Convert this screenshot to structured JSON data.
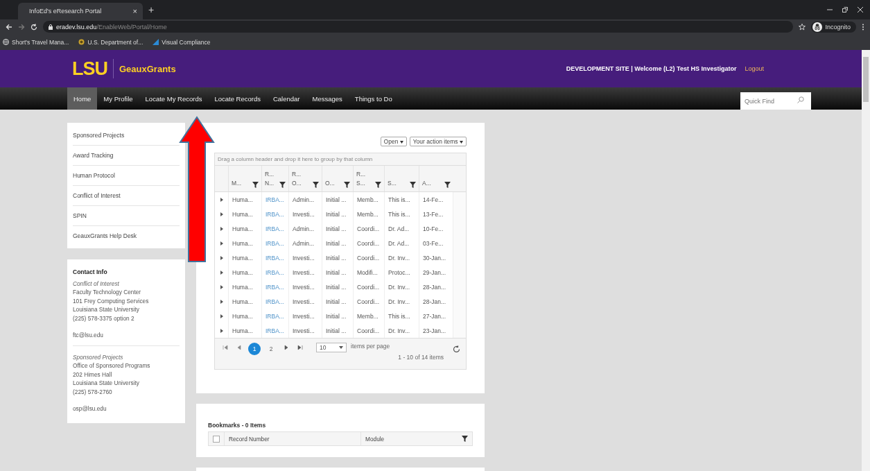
{
  "browser": {
    "tab_title": "InfoEd's eResearch Portal",
    "tab_close": "×",
    "new_tab": "+",
    "url_host": "eradev.lsu.edu",
    "url_path": "/EnableWeb/Portal/Home",
    "profile": "Incognito",
    "bookmarks": [
      "Short's Travel Mana...",
      "U.S. Department of...",
      "Visual Compliance"
    ]
  },
  "header": {
    "logo": "LSU",
    "app_name": "GeauxGrants",
    "welcome": "DEVELOPMENT SITE | Welcome (L2) Test HS Investigator",
    "logout": "Logout"
  },
  "nav": {
    "items": [
      {
        "label": "Home",
        "selected": true
      },
      {
        "label": "My Profile",
        "selected": false
      },
      {
        "label": "Locate My Records",
        "selected": false
      },
      {
        "label": "Locate Records",
        "selected": false
      },
      {
        "label": "Calendar",
        "selected": false
      },
      {
        "label": "Messages",
        "selected": false
      },
      {
        "label": "Things to Do",
        "selected": false
      }
    ],
    "quick_find": {
      "placeholder": "Quick Find"
    }
  },
  "sidebar": {
    "items": [
      "Sponsored Projects",
      "Award Tracking",
      "Human Protocol",
      "Conflict of Interest",
      "SPIN",
      "GeauxGrants Help Desk"
    ]
  },
  "contact": {
    "title": "Contact Info",
    "groups": [
      {
        "unit": "Conflict of Interest",
        "lines": [
          "Faculty Technology Center",
          "101 Frey Computing Services",
          "Louisiana State University",
          "(225) 578-3375 option 2"
        ],
        "email": "ftc@lsu.edu"
      },
      {
        "unit": "Sponsored Projects",
        "lines": [
          "Office of Sponsored Programs",
          "202 Himes Hall",
          "Louisiana State University",
          "(225) 578-2760"
        ],
        "email": "osp@lsu.edu"
      }
    ]
  },
  "grid": {
    "filters": [
      "Open",
      "Your action items"
    ],
    "group_hint": "Drag a column header and drop it here to group by that column",
    "columns": [
      "M...",
      "R... N...",
      "R... O...",
      "O...",
      "R... S...",
      "S...",
      "A..."
    ],
    "rows": [
      [
        "Huma...",
        "IRBA...",
        "Admin...",
        "Initial ...",
        "Memb...",
        "This is...",
        "14-Fe..."
      ],
      [
        "Huma...",
        "IRBA...",
        "Investi...",
        "Initial ...",
        "Memb...",
        "This is...",
        "13-Fe..."
      ],
      [
        "Huma...",
        "IRBA...",
        "Admin...",
        "Initial ...",
        "Coordi...",
        "Dr. Ad...",
        "10-Fe..."
      ],
      [
        "Huma...",
        "IRBA...",
        "Admin...",
        "Initial ...",
        "Coordi...",
        "Dr. Ad...",
        "03-Fe..."
      ],
      [
        "Huma...",
        "IRBA...",
        "Investi...",
        "Initial ...",
        "Coordi...",
        "Dr. Inv...",
        "30-Jan..."
      ],
      [
        "Huma...",
        "IRBA...",
        "Investi...",
        "Initial ...",
        "Modifi...",
        "Protoc...",
        "29-Jan..."
      ],
      [
        "Huma...",
        "IRBA...",
        "Investi...",
        "Initial ...",
        "Coordi...",
        "Dr. Inv...",
        "28-Jan..."
      ],
      [
        "Huma...",
        "IRBA...",
        "Investi...",
        "Initial ...",
        "Coordi...",
        "Dr. Inv...",
        "28-Jan..."
      ],
      [
        "Huma...",
        "IRBA...",
        "Investi...",
        "Initial ...",
        "Memb...",
        "This is...",
        "27-Jan..."
      ],
      [
        "Huma...",
        "IRBA...",
        "Investi...",
        "Initial ...",
        "Coordi...",
        "Dr. Inv...",
        "23-Jan..."
      ]
    ],
    "pages": [
      {
        "label": "1",
        "selected": true
      },
      {
        "label": "2",
        "selected": false
      }
    ],
    "page_size": "10",
    "page_size_label": "items per page",
    "summary": "1 - 10 of 14 items"
  },
  "bookmarks_panel": {
    "title": "Bookmarks - 0 Items",
    "select_all_checked": false,
    "columns": [
      "Record Number",
      "Module"
    ]
  }
}
